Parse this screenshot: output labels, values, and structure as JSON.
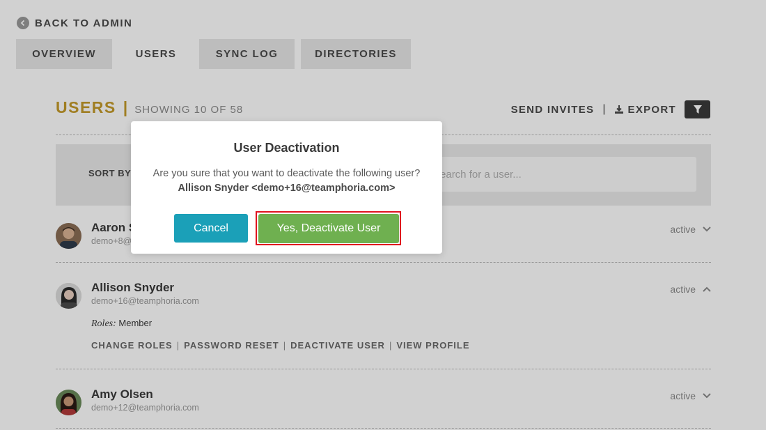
{
  "nav": {
    "back_label": "BACK TO ADMIN"
  },
  "tabs": [
    {
      "label": "OVERVIEW"
    },
    {
      "label": "USERS"
    },
    {
      "label": "SYNC LOG"
    },
    {
      "label": "DIRECTORIES"
    }
  ],
  "header": {
    "title": "USERS",
    "separator": "|",
    "showing": "SHOWING 10 OF 58",
    "send_invites": "SEND INVITES",
    "divider": "|",
    "export": "EXPORT"
  },
  "sort": {
    "label": "SORT BY",
    "search_placeholder": "Search for a user..."
  },
  "users": [
    {
      "name": "Aaron S",
      "email": "demo+8@",
      "status": "active",
      "expanded": false
    },
    {
      "name": "Allison Snyder",
      "email": "demo+16@teamphoria.com",
      "status": "active",
      "expanded": true,
      "roles_label": "Roles:",
      "roles_value": "Member",
      "actions": [
        "CHANGE ROLES",
        "PASSWORD RESET",
        "DEACTIVATE USER",
        "VIEW PROFILE"
      ]
    },
    {
      "name": "Amy Olsen",
      "email": "demo+12@teamphoria.com",
      "status": "active",
      "expanded": false
    }
  ],
  "modal": {
    "title": "User Deactivation",
    "message": "Are you sure that you want to deactivate the following user?",
    "user": "Allison Snyder <demo+16@teamphoria.com>",
    "cancel_label": "Cancel",
    "confirm_label": "Yes, Deactivate User"
  },
  "colors": {
    "accent_gold": "#c49a2a",
    "cancel_teal": "#1ba0b8",
    "confirm_green": "#6fb050",
    "highlight_red": "#e0131f"
  }
}
